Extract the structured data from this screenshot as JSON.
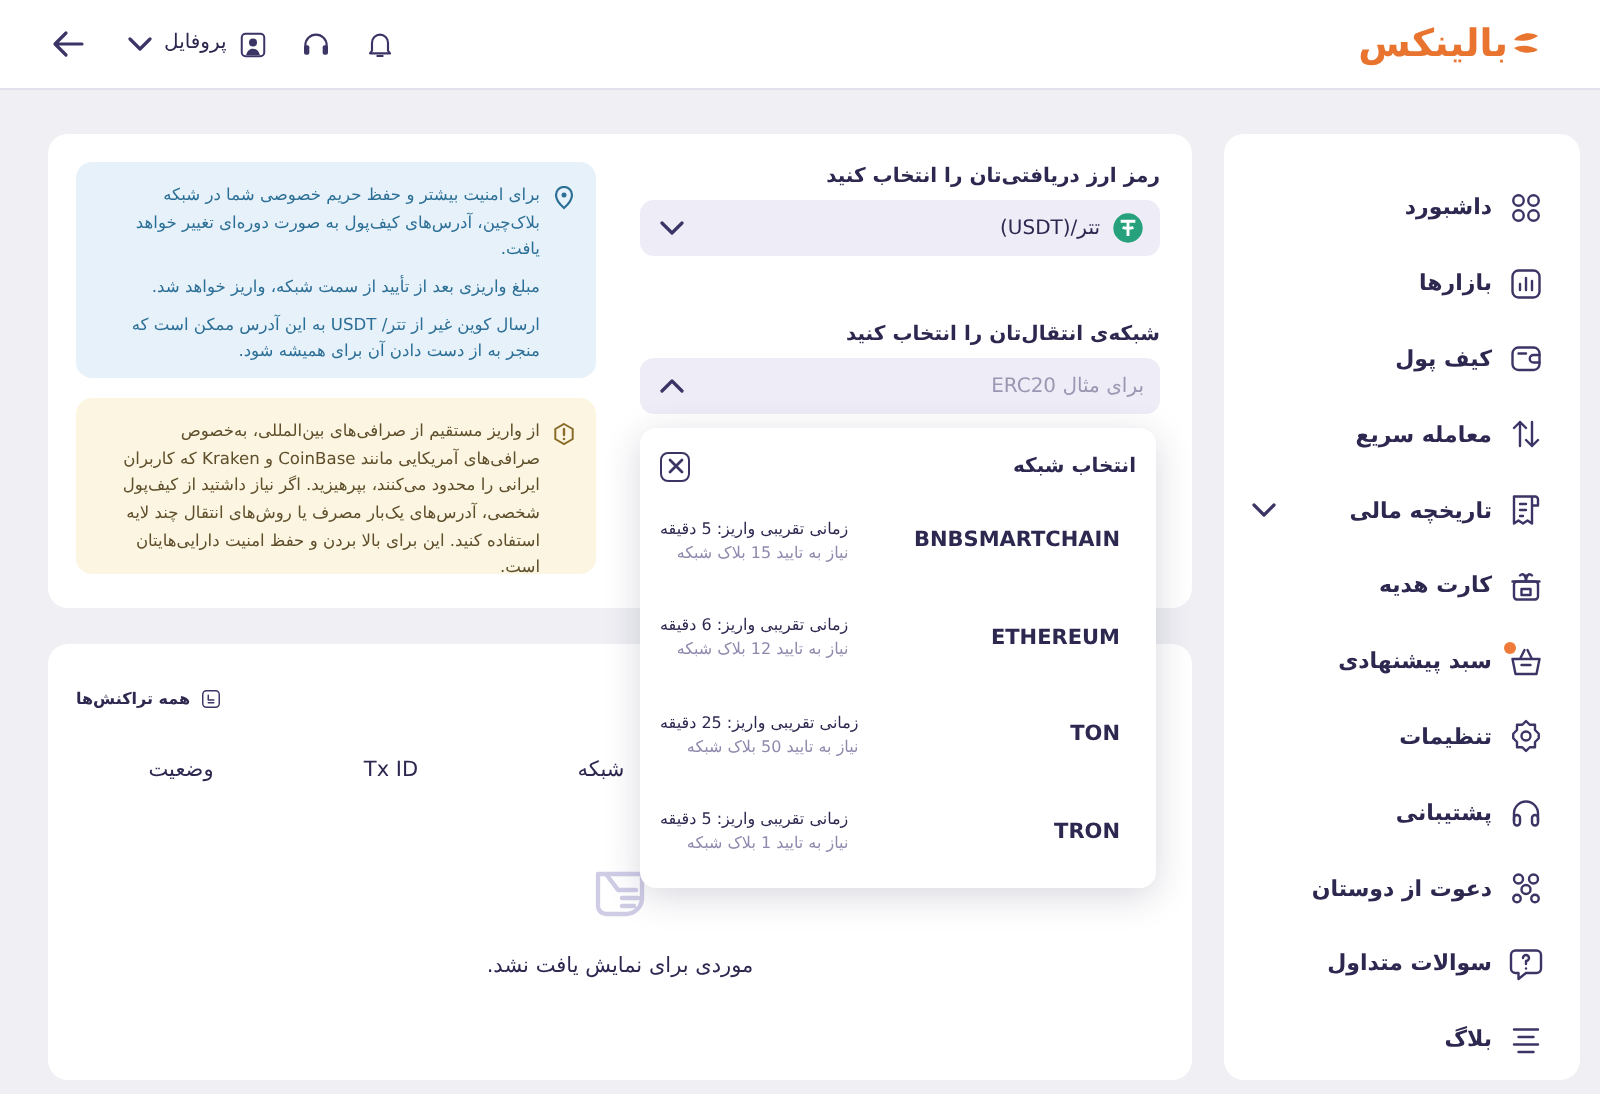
{
  "header": {
    "logo": "بالینکس",
    "profile": "پروفایل"
  },
  "sidebar": {
    "items": [
      {
        "label": "داشبورد",
        "kind": "link",
        "notification": false
      },
      {
        "label": "بازارها",
        "kind": "link",
        "notification": false
      },
      {
        "label": "کیف پول",
        "kind": "link",
        "notification": false
      },
      {
        "label": "معامله سریع",
        "kind": "link",
        "notification": false
      },
      {
        "label": "تاریخچه مالی",
        "kind": "group",
        "notification": false
      },
      {
        "label": "کارت هدیه",
        "kind": "link",
        "notification": false
      },
      {
        "label": "سبد پیشنهادی",
        "kind": "link",
        "notification": true
      },
      {
        "label": "تنظیمات",
        "kind": "link",
        "notification": false
      },
      {
        "label": "پشتیبانی",
        "kind": "link",
        "notification": false
      },
      {
        "label": "دعوت از دوستان",
        "kind": "link",
        "notification": false
      },
      {
        "label": "سوالات متداول",
        "kind": "link",
        "notification": false
      },
      {
        "label": "بلاگ",
        "kind": "link",
        "notification": false
      }
    ]
  },
  "deposit_form": {
    "coin_label": "رمز ارز دریافتی‌تان را انتخاب کنید",
    "coin_select": {
      "value": "تتر/(USDT)",
      "expanded": false
    },
    "network_label": "شبکه‌ی انتقال‌تان را انتخاب کنید",
    "network_select": {
      "placeholder": "برای مثال ERC20",
      "expanded": true
    }
  },
  "notices": [
    {
      "kind": "info",
      "paragraphs": [
        "برای امنیت بیشتر و حفظ حریم خصوصی شما در شبکه بلاک‌چین، آدرس‌های کیف‌پول به صورت دوره‌ای تغییر خواهد یافت.",
        "مبلغ واریزی بعد از تأیید از سمت شبکه، واریز خواهد شد.",
        "ارسال کوین غیر از تتر/ USDT به این آدرس ممکن است که منجر به از دست دادن آن برای همیشه شود."
      ]
    },
    {
      "kind": "warning",
      "paragraphs": [
        "از واریز مستقیم از صرافی‌های بین‌المللی، به‌خصوص صرافی‌های آمریکایی مانند CoinBase و Kraken که کاربران ایرانی را محدود می‌کنند، بپرهیزید. اگر نیاز داشتید از کیف‌پول شخصی، آدرس‌های یک‌بار مصرف یا روش‌های انتقال چند لایه استفاده کنید. این برای بالا بردن و حفظ امنیت دارایی‌هایتان است."
      ]
    }
  ],
  "transactions": {
    "link": "همه تراکنش‌ها",
    "columns": [
      "شبکه",
      "Tx ID",
      "وضعیت"
    ],
    "empty_message": "موردی برای نمایش یافت نشد."
  },
  "network_popup": {
    "title": "انتخاب شبکه",
    "networks": [
      {
        "name": "BNBSMARTCHAIN",
        "time": "زمانی تقریبی واریز: 5 دقیقه",
        "confirmations": "نیاز به تایید 15 بلاک شبکه"
      },
      {
        "name": "ETHEREUM",
        "time": "زمانی تقریبی واریز: 6 دقیقه",
        "confirmations": "نیاز به تایید 12 بلاک شبکه"
      },
      {
        "name": "TON",
        "time": "زمانی تقریبی واریز: 25 دقیقه",
        "confirmations": "نیاز به تایید 50 بلاک شبکه"
      },
      {
        "name": "TRON",
        "time": "زمانی تقریبی واریز: 5 دقیقه",
        "confirmations": "نیاز به تایید 1 بلاک شبکه"
      }
    ]
  }
}
